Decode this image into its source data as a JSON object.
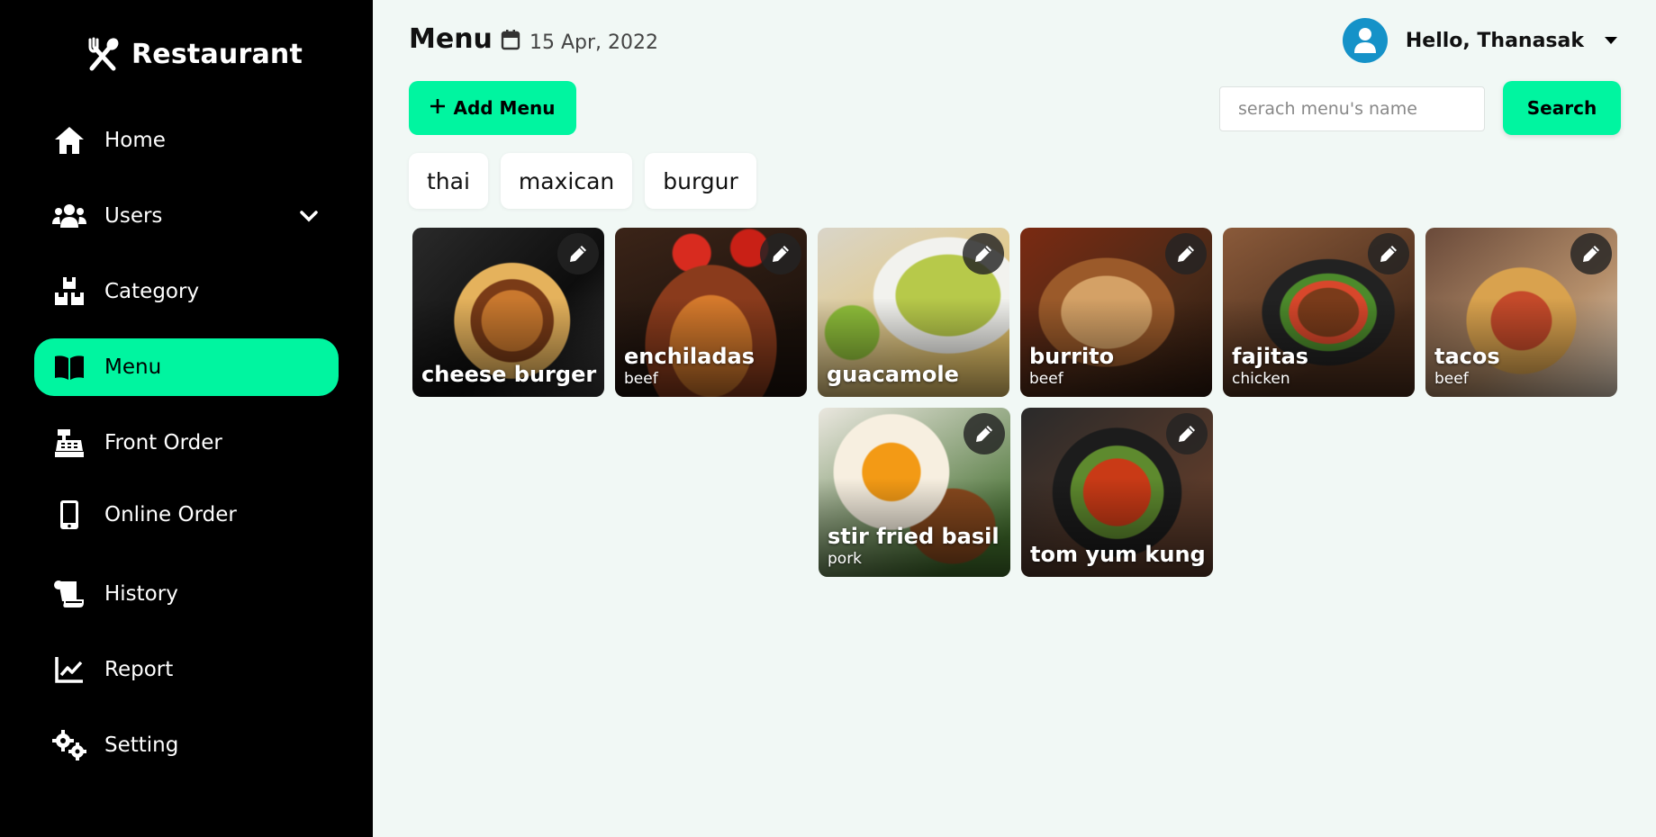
{
  "app": {
    "brand": "Restaurant"
  },
  "sidebar": {
    "items": [
      {
        "label": "Home",
        "icon": "home-icon"
      },
      {
        "label": "Users",
        "icon": "users-icon",
        "expandable": true
      },
      {
        "label": "Category",
        "icon": "boxes-icon"
      },
      {
        "label": "Menu",
        "icon": "book-icon",
        "active": true
      },
      {
        "label": "Front Order",
        "icon": "cash-register-icon"
      },
      {
        "label": "Online Order",
        "icon": "mobile-icon"
      },
      {
        "label": "History",
        "icon": "scroll-icon"
      },
      {
        "label": "Report",
        "icon": "chart-line-icon"
      },
      {
        "label": "Setting",
        "icon": "gears-icon"
      }
    ]
  },
  "header": {
    "title": "Menu",
    "date": "15 Apr, 2022",
    "greeting": "Hello, Thanasak"
  },
  "toolbar": {
    "add_label": "Add Menu",
    "search_placeholder": "serach menu's name",
    "search_value": "",
    "search_label": "Search"
  },
  "categories": [
    "thai",
    "maxican",
    "burgur"
  ],
  "menu_items": [
    {
      "name": "cheese burger",
      "sub": ""
    },
    {
      "name": "enchiladas",
      "sub": "beef"
    },
    {
      "name": "guacamole",
      "sub": ""
    },
    {
      "name": "burrito",
      "sub": "beef"
    },
    {
      "name": "fajitas",
      "sub": "chicken"
    },
    {
      "name": "tacos",
      "sub": "beef"
    },
    {
      "name": "stir fried basil",
      "sub": "pork"
    },
    {
      "name": "tom yum kung",
      "sub": ""
    }
  ],
  "colors": {
    "accent": "#00f5a0",
    "sidebar_bg": "#000000",
    "page_bg": "#f1f8f5",
    "avatar": "#1592c8"
  }
}
